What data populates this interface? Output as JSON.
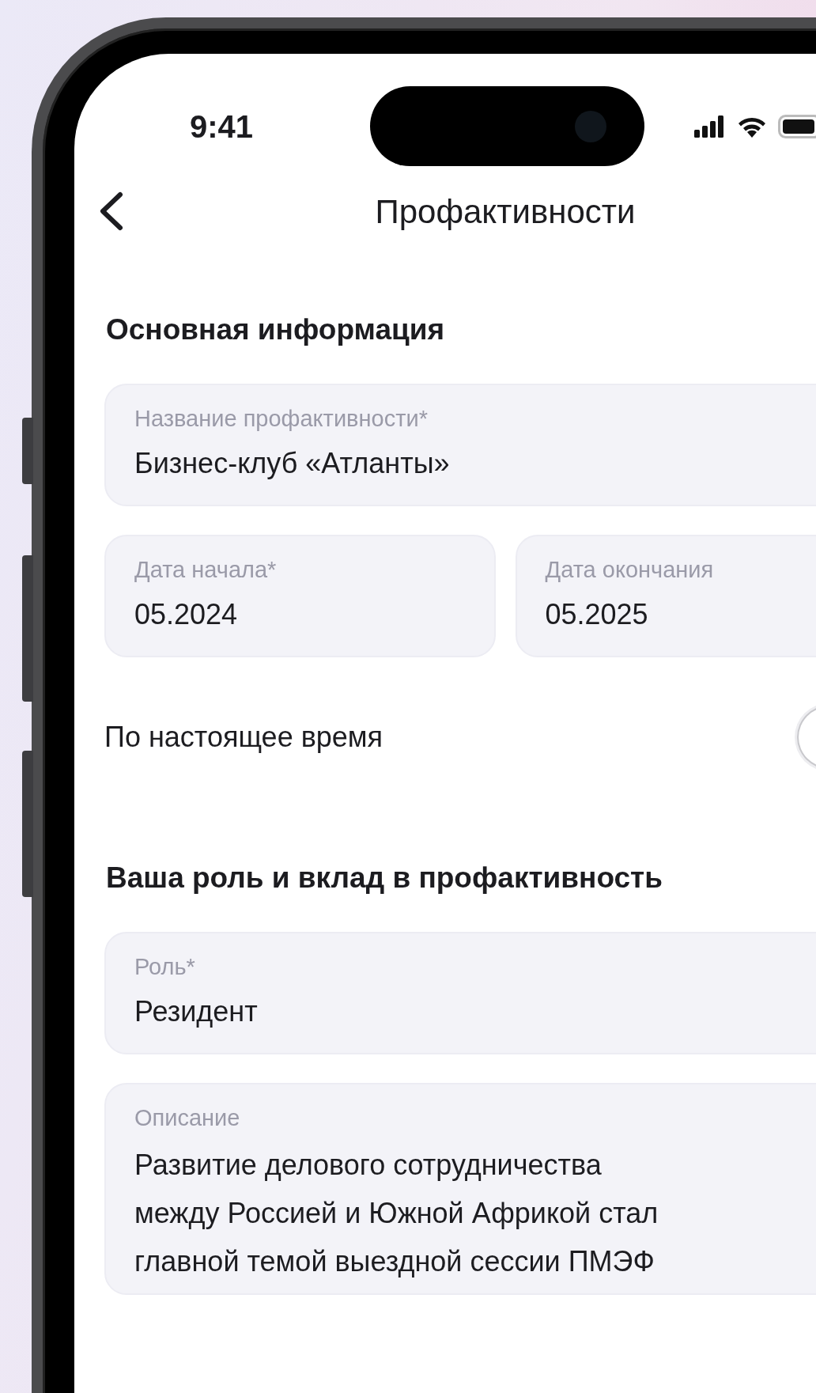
{
  "status_bar": {
    "time": "9:41"
  },
  "header": {
    "title": "Профактивности"
  },
  "sections": [
    {
      "title": "Основная информация",
      "rows": [
        {
          "kind": "field",
          "label": "Название профактивности*",
          "value": "Бизнес-клуб «Атланты»"
        },
        {
          "kind": "field_pair",
          "fields": [
            {
              "label": "Дата начала*",
              "value": "05.2024"
            },
            {
              "label": "Дата окончания",
              "value": "05.2025"
            }
          ]
        },
        {
          "kind": "toggle",
          "label": "По настоящее время",
          "on": false
        }
      ]
    },
    {
      "title": "Ваша роль и вклад в профактивность",
      "rows": [
        {
          "kind": "field",
          "label": "Роль*",
          "value": "Резидент"
        },
        {
          "kind": "textarea",
          "label": "Описание",
          "value_lines": [
            "Развитие делового сотрудничества",
            "между Россией и Южной Африкой стал",
            "главной темой выездной сессии ПМЭФ"
          ]
        }
      ]
    }
  ]
}
